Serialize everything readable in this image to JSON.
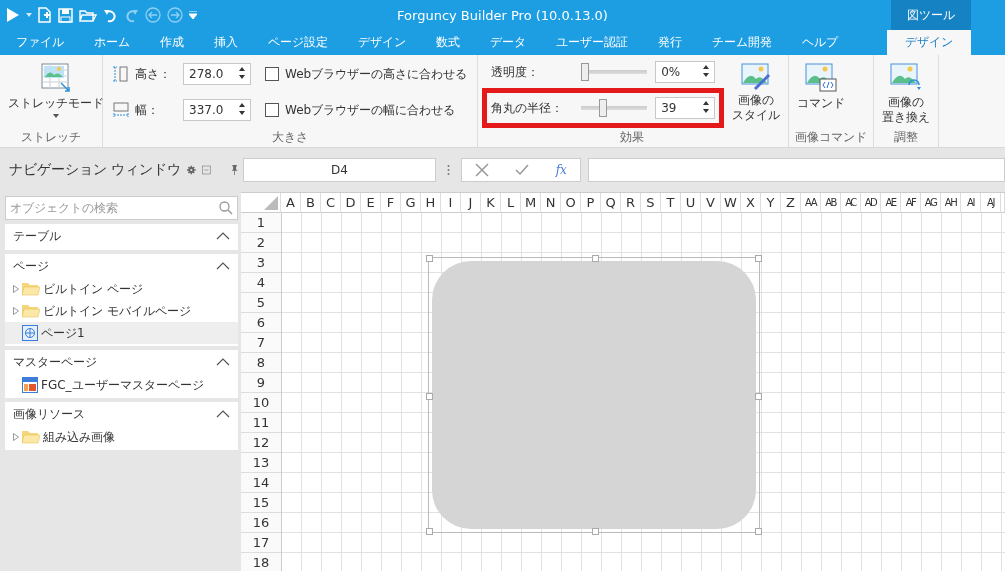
{
  "title_bar": {
    "title": "Forguncy Builder Pro (10.0.13.0)",
    "context_tab": "図ツール"
  },
  "tabs": [
    {
      "label": "ファイル",
      "selected": false
    },
    {
      "label": "ホーム",
      "selected": false
    },
    {
      "label": "作成",
      "selected": false
    },
    {
      "label": "挿入",
      "selected": false
    },
    {
      "label": "ページ設定",
      "selected": false
    },
    {
      "label": "デザイン",
      "selected": false
    },
    {
      "label": "数式",
      "selected": false
    },
    {
      "label": "データ",
      "selected": false
    },
    {
      "label": "ユーザー認証",
      "selected": false
    },
    {
      "label": "発行",
      "selected": false
    },
    {
      "label": "チーム開発",
      "selected": false
    },
    {
      "label": "ヘルプ",
      "selected": false
    },
    {
      "label": "デザイン",
      "selected": true
    }
  ],
  "ribbon": {
    "stretch": {
      "button": "ストレッチモード",
      "group": "ストレッチ"
    },
    "size": {
      "group": "大きさ",
      "fields": [
        {
          "kind": "height",
          "label": "高さ：",
          "value": "278.0",
          "fit_label": "Webブラウザーの高さに合わせる",
          "checked": false
        },
        {
          "kind": "width",
          "label": "幅：",
          "value": "337.0",
          "fit_label": "Webブラウザーの幅に合わせる",
          "checked": false
        }
      ]
    },
    "effects": {
      "group": "効果",
      "style_button": [
        "画像の",
        "スタイル"
      ],
      "sliders": [
        {
          "label": "透明度：",
          "level": 0,
          "value": "0%",
          "highlighted": false
        },
        {
          "label": "角丸の半径：",
          "level": 0.3,
          "value": "39",
          "highlighted": true
        }
      ]
    },
    "image_command": {
      "group": "画像コマンド",
      "button": "コマンド"
    },
    "adjust": {
      "group": "調整",
      "button": [
        "画像の",
        "置き換え"
      ]
    }
  },
  "navigation": {
    "title": "ナビゲーション ウィンドウ",
    "search": {
      "placeholder": "オブジェクトの検索"
    },
    "sections": [
      {
        "title": "テーブル",
        "expanded": true
      },
      {
        "title": "ページ",
        "expanded": true,
        "items": [
          {
            "kind": "folder",
            "label": "ビルトイン ページ",
            "expanded": false,
            "selected": false
          },
          {
            "kind": "folder",
            "label": "ビルトイン モバイルページ",
            "expanded": false,
            "selected": false
          },
          {
            "kind": "page",
            "label": "ページ1",
            "selected": true
          }
        ]
      },
      {
        "title": "マスターページ",
        "expanded": true,
        "items": [
          {
            "kind": "master",
            "label": "FGC_ユーザーマスターページ",
            "selected": false
          }
        ]
      },
      {
        "title": "画像リソース",
        "expanded": true,
        "items": [
          {
            "kind": "folder",
            "label": "組み込み画像",
            "expanded": false,
            "selected": false
          }
        ]
      }
    ]
  },
  "formula_bar": {
    "name_box": "D4",
    "function_button": "fx"
  },
  "sheet": {
    "columns": [
      "A",
      "B",
      "C",
      "D",
      "E",
      "F",
      "G",
      "H",
      "I",
      "J",
      "K",
      "L",
      "M",
      "N",
      "O",
      "P",
      "Q",
      "R",
      "S",
      "T",
      "U",
      "V",
      "W",
      "X",
      "Y",
      "Z",
      "AA",
      "AB",
      "AC",
      "AD",
      "AE",
      "AF",
      "AG",
      "AH",
      "AI",
      "AJ"
    ],
    "rows": [
      "1",
      "2",
      "3",
      "4",
      "5",
      "6",
      "7",
      "8",
      "9",
      "10",
      "11",
      "12",
      "13",
      "14",
      "15",
      "16",
      "17",
      "18"
    ],
    "image_shape": {
      "selected": true
    }
  }
}
